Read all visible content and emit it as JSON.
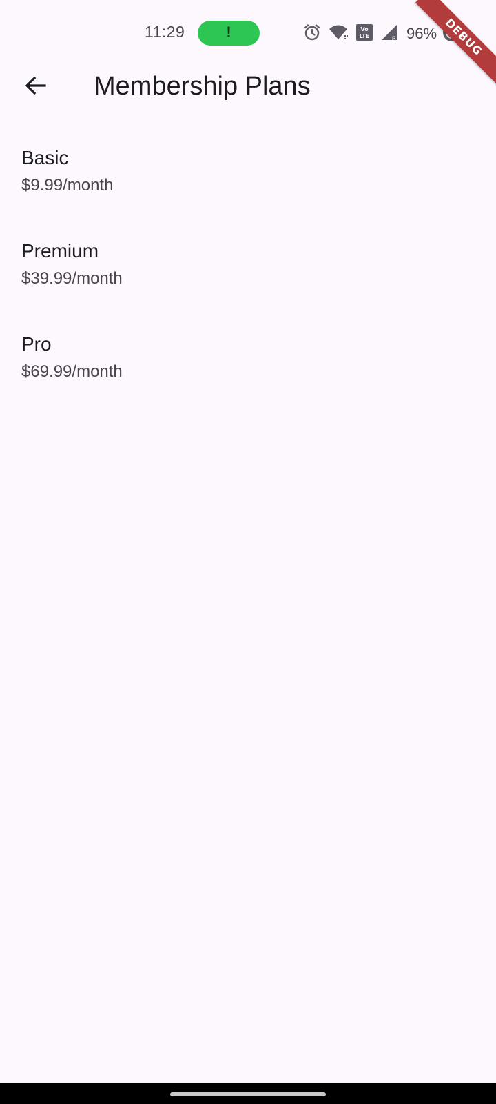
{
  "status_bar": {
    "time": "11:29",
    "call_indicator": "!",
    "battery_percent": "96%",
    "icons": [
      "alarm-icon",
      "wifi-icon",
      "volte-icon",
      "signal-icon",
      "battery-icon"
    ],
    "debug_label": "DEBUG"
  },
  "app_bar": {
    "title": "Membership Plans",
    "back_icon": "arrow-back-icon"
  },
  "plans": [
    {
      "name": "Basic",
      "price": "$9.99/month"
    },
    {
      "name": "Premium",
      "price": "$39.99/month"
    },
    {
      "name": "Pro",
      "price": "$69.99/month"
    }
  ],
  "colors": {
    "background": "#fdf7fe",
    "call_pill": "#2dc653",
    "debug_ribbon": "#b23b3b",
    "primary_text": "#1d1b20",
    "secondary_text": "#49454f"
  }
}
